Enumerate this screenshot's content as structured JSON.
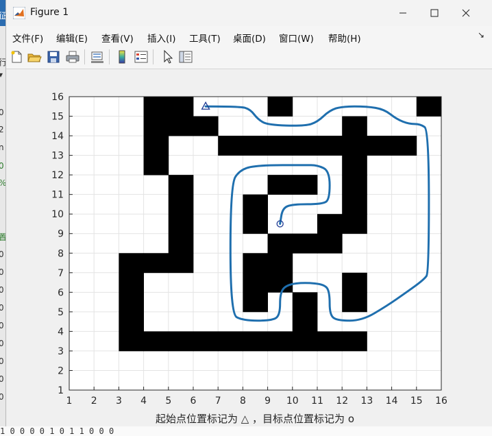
{
  "window": {
    "title": "Figure 1"
  },
  "menu": {
    "items": [
      "文件(F)",
      "编辑(E)",
      "查看(V)",
      "插入(I)",
      "工具(T)",
      "桌面(D)",
      "窗口(W)",
      "帮助(H)"
    ],
    "overflow_icon": "dock-arrow-icon"
  },
  "toolbar": {
    "icons": [
      "new-figure-icon",
      "open-file-icon",
      "save-icon",
      "print-icon",
      "link-plot-icon",
      "colorbar-icon",
      "legend-icon",
      "select-arrow-icon",
      "property-inspector-icon"
    ]
  },
  "background": {
    "left_glyphs": [
      "征",
      "行",
      "▾",
      "0",
      "2",
      "n",
      "0",
      "%",
      "置",
      "0",
      "0",
      "0",
      "0",
      "0",
      "0",
      "0",
      "0",
      "0"
    ],
    "bottom_text": "  1   0  0  0  0  1   0  1  1  0  0  0"
  },
  "chart_data": {
    "type": "occupancy-grid-path",
    "xlabel": "起始点位置标记为 △ ，目标点位置标记为 o",
    "ylabel": "",
    "xlim": [
      1,
      16
    ],
    "ylim": [
      1,
      16
    ],
    "xticks": [
      1,
      2,
      3,
      4,
      5,
      6,
      7,
      8,
      9,
      10,
      11,
      12,
      13,
      14,
      15,
      16
    ],
    "yticks": [
      1,
      2,
      3,
      4,
      5,
      6,
      7,
      8,
      9,
      10,
      11,
      12,
      13,
      14,
      15,
      16
    ],
    "grid": true,
    "obstacle_cells": [
      [
        4,
        15
      ],
      [
        5,
        15
      ],
      [
        9,
        15
      ],
      [
        15,
        15
      ],
      [
        4,
        14
      ],
      [
        5,
        14
      ],
      [
        6,
        14
      ],
      [
        12,
        14
      ],
      [
        4,
        13
      ],
      [
        7,
        13
      ],
      [
        8,
        13
      ],
      [
        9,
        13
      ],
      [
        10,
        13
      ],
      [
        11,
        13
      ],
      [
        12,
        13
      ],
      [
        13,
        13
      ],
      [
        14,
        13
      ],
      [
        4,
        12
      ],
      [
        12,
        12
      ],
      [
        5,
        11
      ],
      [
        9,
        11
      ],
      [
        10,
        11
      ],
      [
        12,
        11
      ],
      [
        5,
        10
      ],
      [
        8,
        10
      ],
      [
        12,
        10
      ],
      [
        5,
        9
      ],
      [
        8,
        9
      ],
      [
        11,
        9
      ],
      [
        12,
        9
      ],
      [
        5,
        8
      ],
      [
        9,
        8
      ],
      [
        10,
        8
      ],
      [
        11,
        8
      ],
      [
        3,
        7
      ],
      [
        4,
        7
      ],
      [
        5,
        7
      ],
      [
        8,
        7
      ],
      [
        9,
        7
      ],
      [
        3,
        6
      ],
      [
        8,
        6
      ],
      [
        9,
        6
      ],
      [
        12,
        6
      ],
      [
        3,
        5
      ],
      [
        8,
        5
      ],
      [
        10,
        5
      ],
      [
        12,
        5
      ],
      [
        3,
        4
      ],
      [
        10,
        4
      ],
      [
        3,
        3
      ],
      [
        4,
        3
      ],
      [
        5,
        3
      ],
      [
        6,
        3
      ],
      [
        7,
        3
      ],
      [
        8,
        3
      ],
      [
        9,
        3
      ],
      [
        10,
        3
      ],
      [
        11,
        3
      ],
      [
        12,
        3
      ]
    ],
    "start": [
      6.5,
      15.5
    ],
    "goal": [
      9.5,
      9.5
    ],
    "path": [
      [
        6.5,
        15.5
      ],
      [
        7.9,
        15.5
      ],
      [
        8.3,
        15.35
      ],
      [
        8.6,
        14.85
      ],
      [
        9.0,
        14.55
      ],
      [
        10.5,
        14.5
      ],
      [
        11.0,
        14.7
      ],
      [
        11.5,
        15.3
      ],
      [
        12.0,
        15.5
      ],
      [
        13.0,
        15.5
      ],
      [
        13.7,
        15.35
      ],
      [
        14.2,
        14.85
      ],
      [
        14.7,
        14.6
      ],
      [
        15.15,
        14.6
      ],
      [
        15.5,
        14.3
      ],
      [
        15.5,
        7.0
      ],
      [
        15.3,
        6.65
      ],
      [
        14.6,
        6.0
      ],
      [
        13.8,
        5.3
      ],
      [
        12.8,
        4.55
      ],
      [
        11.8,
        4.55
      ],
      [
        11.5,
        4.85
      ],
      [
        11.5,
        6.0
      ],
      [
        11.3,
        6.4
      ],
      [
        10.5,
        6.5
      ],
      [
        9.8,
        6.4
      ],
      [
        9.5,
        6.0
      ],
      [
        9.5,
        4.85
      ],
      [
        9.2,
        4.55
      ],
      [
        8.0,
        4.55
      ],
      [
        7.5,
        4.9
      ],
      [
        7.5,
        11.5
      ],
      [
        7.9,
        12.3
      ],
      [
        8.7,
        12.5
      ],
      [
        10.5,
        12.5
      ],
      [
        11.0,
        12.5
      ],
      [
        11.5,
        12.2
      ],
      [
        11.5,
        10.75
      ],
      [
        11.2,
        10.5
      ],
      [
        10.0,
        10.5
      ],
      [
        9.6,
        10.3
      ],
      [
        9.5,
        9.5
      ]
    ],
    "obstacle_color": "#000000",
    "path_color": "#1f6fae",
    "marker_color": "#1f3a93"
  }
}
